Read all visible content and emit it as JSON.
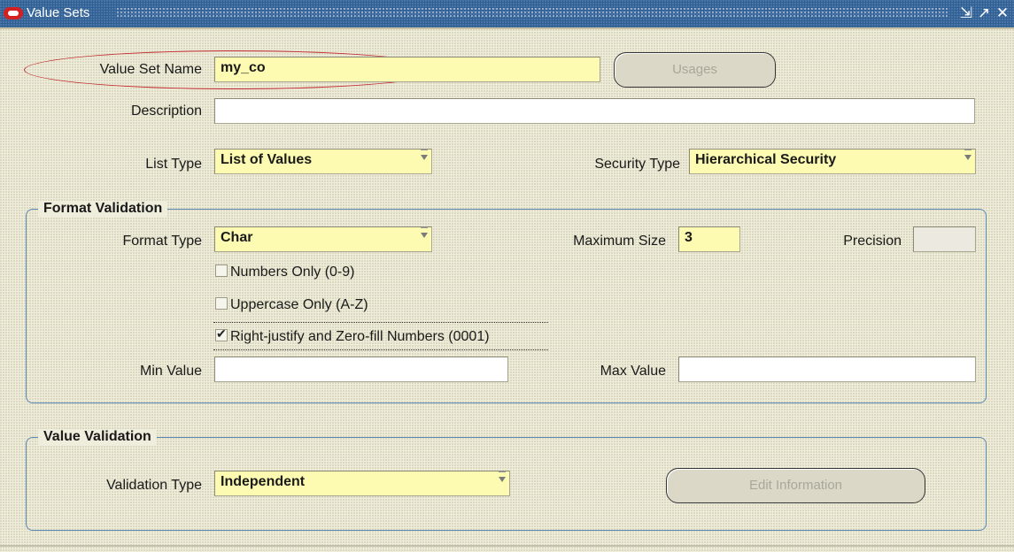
{
  "window": {
    "title": "Value Sets",
    "controls": [
      "minimize-icon",
      "maximize-icon",
      "close-icon"
    ]
  },
  "value_set_name": {
    "label": "Value Set Name",
    "value": "my_co"
  },
  "usages_button": {
    "label": "Usages",
    "enabled": false
  },
  "description": {
    "label": "Description",
    "value": ""
  },
  "list_type": {
    "label": "List Type",
    "value": "List of Values"
  },
  "security_type": {
    "label": "Security Type",
    "value": "Hierarchical Security"
  },
  "format_validation": {
    "title": "Format Validation",
    "format_type": {
      "label": "Format Type",
      "value": "Char"
    },
    "maximum_size": {
      "label": "Maximum Size",
      "value": "3"
    },
    "precision": {
      "label": "Precision",
      "value": ""
    },
    "numbers_only": {
      "label": "Numbers Only (0-9)",
      "checked": false
    },
    "uppercase_only": {
      "label": "Uppercase Only (A-Z)",
      "checked": false
    },
    "right_justify": {
      "label": "Right-justify and Zero-fill Numbers (0001)",
      "checked": true
    },
    "min_value": {
      "label": "Min Value",
      "value": ""
    },
    "max_value": {
      "label": "Max Value",
      "value": ""
    }
  },
  "value_validation": {
    "title": "Value Validation",
    "validation_type": {
      "label": "Validation Type",
      "value": "Independent"
    },
    "edit_information_button": {
      "label": "Edit Information",
      "enabled": false
    }
  },
  "colors": {
    "title_bar": "#2f5f94",
    "required_field": "#fdfbb1",
    "highlight_oval": "#c0292c",
    "group_border": "#5a88b4"
  }
}
